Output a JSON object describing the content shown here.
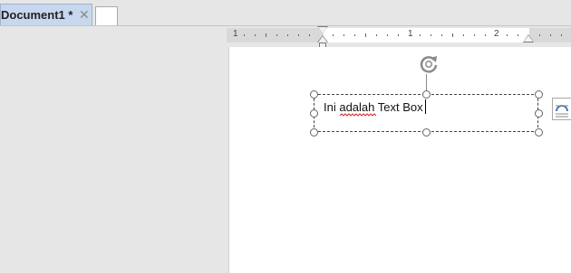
{
  "tab": {
    "label": "Document1 *",
    "close_glyph": "✕"
  },
  "ruler": {
    "left_label": "1",
    "mid_label": "1",
    "right_label": "2"
  },
  "textbox": {
    "text": "Ini adalah Text Box"
  },
  "icons": {
    "rotate": "rotate-icon",
    "layout_options": "layout-options-icon"
  },
  "colors": {
    "tab_active": "#c7d7ee",
    "app_background": "#e6e6e6",
    "page": "#ffffff"
  }
}
